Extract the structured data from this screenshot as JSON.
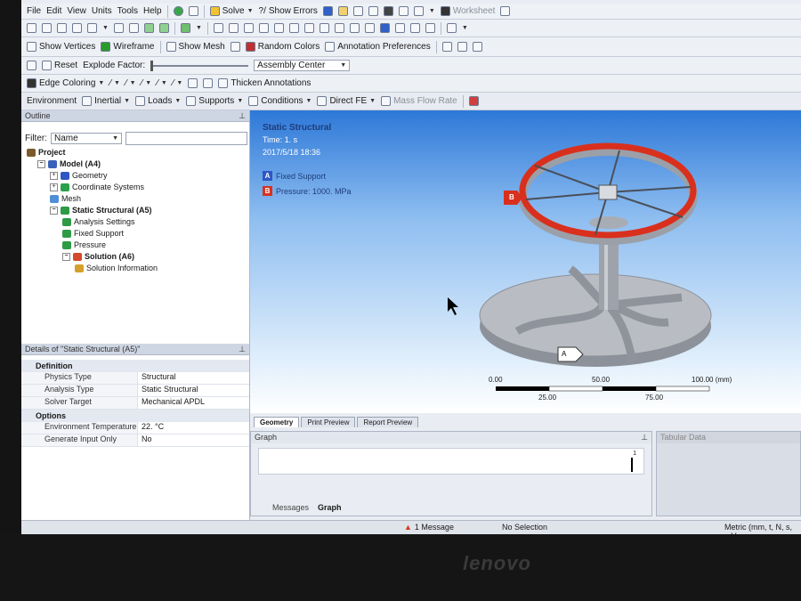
{
  "menu": [
    "File",
    "Edit",
    "View",
    "Units",
    "Tools",
    "Help"
  ],
  "toolbar1": {
    "solve": "Solve",
    "show_errors": "Show Errors",
    "worksheet": "Worksheet"
  },
  "toolbar2": {
    "show_vertices": "Show Vertices",
    "wireframe": "Wireframe",
    "show_mesh": "Show Mesh",
    "random_colors": "Random Colors",
    "annotation_preferences": "Annotation Preferences"
  },
  "toolbar3": {
    "reset": "Reset",
    "explode_factor": "Explode Factor:",
    "assembly_center": "Assembly Center"
  },
  "toolbar4": {
    "edge_coloring": "Edge Coloring",
    "thicken_annotations": "Thicken Annotations"
  },
  "toolbar5": {
    "environment": "Environment",
    "inertial": "Inertial",
    "loads": "Loads",
    "supports": "Supports",
    "conditions": "Conditions",
    "direct_fe": "Direct FE",
    "mass_flow_rate": "Mass Flow Rate"
  },
  "outline": {
    "title": "Outline",
    "filter_label": "Filter:",
    "filter_value": "Name",
    "tree": [
      {
        "label": "Project",
        "bold": true,
        "color": "#7a5a2a"
      },
      {
        "label": "Model (A4)",
        "bold": true,
        "color": "#3a62b8"
      },
      {
        "label": "Geometry",
        "bold": false,
        "color": "#2f57c4"
      },
      {
        "label": "Coordinate Systems",
        "bold": false,
        "color": "#2aa04a"
      },
      {
        "label": "Mesh",
        "bold": false,
        "color": "#4f8fd8"
      },
      {
        "label": "Static Structural (A5)",
        "bold": true,
        "color": "#2f9a45"
      },
      {
        "label": "Analysis Settings",
        "bold": false,
        "color": "#2f9a45"
      },
      {
        "label": "Fixed Support",
        "bold": false,
        "color": "#2f9a45"
      },
      {
        "label": "Pressure",
        "bold": false,
        "color": "#2f9a45"
      },
      {
        "label": "Solution (A6)",
        "bold": true,
        "color": "#d44a2a"
      },
      {
        "label": "Solution Information",
        "bold": false,
        "color": "#d4a02a"
      }
    ]
  },
  "details": {
    "title": "Details of \"Static Structural (A5)\"",
    "section_definition": "Definition",
    "rows_def": [
      {
        "k": "Physics Type",
        "v": "Structural"
      },
      {
        "k": "Analysis Type",
        "v": "Static Structural"
      },
      {
        "k": "Solver Target",
        "v": "Mechanical APDL"
      }
    ],
    "section_options": "Options",
    "rows_opt": [
      {
        "k": "Environment Temperature",
        "v": "22. °C"
      },
      {
        "k": "Generate Input Only",
        "v": "No"
      }
    ]
  },
  "viewport": {
    "title": "Static Structural",
    "time": "Time: 1. s",
    "date": "2017/5/18 18:36",
    "legend": [
      {
        "letter": "A",
        "label": "Fixed Support",
        "color": "#2f57c4"
      },
      {
        "letter": "B",
        "label": "Pressure: 1000. MPa",
        "color": "#d9301e"
      }
    ],
    "scale_top": [
      "0.00",
      "50.00",
      "100.00 (mm)"
    ],
    "scale_bottom": [
      "25.00",
      "75.00"
    ],
    "marker_a": "A",
    "marker_b": "B"
  },
  "tabs": [
    "Geometry",
    "Print Preview",
    "Report Preview"
  ],
  "graph": {
    "title": "Graph",
    "axis_tick": "1",
    "messages_tab": "Messages",
    "graph_tab": "Graph"
  },
  "tabular": {
    "title": "Tabular Data"
  },
  "status": {
    "message": "1 Message",
    "selection": "No Selection",
    "units": "Metric (mm, t, N, s, mV"
  },
  "brand": "lenovo"
}
